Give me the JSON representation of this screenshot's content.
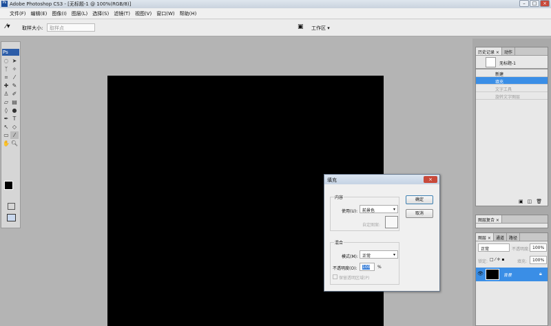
{
  "window": {
    "title": "Adobe Photoshop CS3 - [无标题-1 @ 100%(RGB/8)]",
    "app_icon": "Ps"
  },
  "menu": [
    "文件(F)",
    "编辑(E)",
    "图像(I)",
    "图层(L)",
    "选择(S)",
    "滤镜(T)",
    "视图(V)",
    "窗口(W)",
    "帮助(H)"
  ],
  "options": {
    "sample_label": "取样大小:",
    "sample_value": "取样点",
    "workspace": "工作区 ▾"
  },
  "toolbox": {
    "logo": "Ps",
    "foreground": "#000000",
    "background": "#ffffff"
  },
  "history": {
    "tabs": [
      "历史记录 ×",
      "动作"
    ],
    "snapshot": "无标题-1",
    "items": [
      {
        "label": "新建",
        "state": "normal"
      },
      {
        "label": "填充",
        "state": "selected"
      },
      {
        "label": "文字工具",
        "state": "dim"
      },
      {
        "label": "旋转文字图层",
        "state": "dim"
      }
    ]
  },
  "comps": {
    "tab": "图层复合 ×"
  },
  "layers": {
    "tabs": [
      "图层 ×",
      "通道",
      "路径"
    ],
    "blend": "正常",
    "opacity_label": "不透明度:",
    "opacity": "100%",
    "lock_label": "锁定:",
    "fill_label": "填充:",
    "fill": "100%",
    "layer_name": "背景"
  },
  "dialog": {
    "title": "填充",
    "close": "×",
    "content_group": "内容",
    "use_label": "使用(U):",
    "use_value": "前景色",
    "pattern_label": "自定图案:",
    "blend_group": "混合",
    "mode_label": "模式(M):",
    "mode_value": "正常",
    "opacity_label": "不透明度(O):",
    "opacity_value": "100",
    "percent": "%",
    "preserve_label": "保留透明区域(P)",
    "ok": "确定",
    "cancel": "取消"
  },
  "colors": {
    "selection": "#3a8ee6",
    "canvas": "#000000"
  }
}
